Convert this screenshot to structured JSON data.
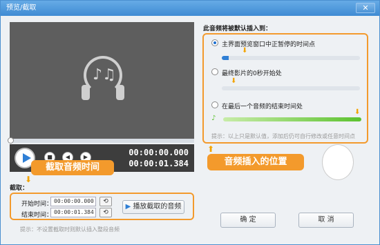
{
  "window": {
    "title": "预览/截取",
    "close_icon": "close-icon"
  },
  "player": {
    "cover_icon": "headphones-music-icon",
    "time_top": "00:00:00.000",
    "time_bottom": "00:00:01.384",
    "progress_fraction": 0.01
  },
  "trim": {
    "callout": "截取音频时间",
    "section_label": "截取：",
    "start_label": "开始时间：",
    "start_value": "00:00:00.000",
    "end_label": "结束时间：",
    "end_value": "00:00:01.384",
    "play_button": "播放截取的音频",
    "hint": "提示：不设置截取时则默认插入整段音频"
  },
  "insert": {
    "title": "此音频将被默认插入到：",
    "option1": "主界面预览窗口中正暂停的时间点",
    "option2": "最终影片的0秒开始处",
    "option3": "在最后一个音频的结束时间处",
    "hint": "提示：以上只是默认值，添加后仍可自行修改或任意时间点",
    "callout": "音频插入的位置",
    "selected_option": 1,
    "accent": "#f39a2c"
  },
  "buttons": {
    "ok": "确  定",
    "cancel": "取  消"
  }
}
